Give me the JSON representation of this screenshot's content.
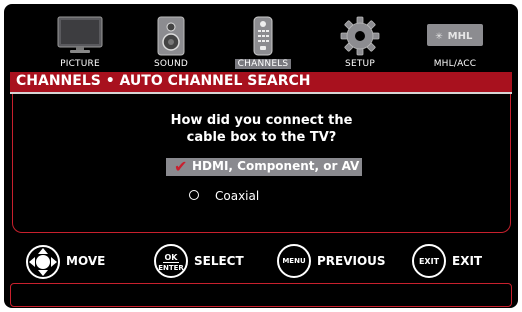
{
  "menu": {
    "tabs": [
      {
        "label": "PICTURE",
        "icon": "monitor-icon",
        "active": false
      },
      {
        "label": "SOUND",
        "icon": "speaker-icon",
        "active": false
      },
      {
        "label": "CHANNELS",
        "icon": "remote-icon",
        "active": true
      },
      {
        "label": "SETUP",
        "icon": "gear-icon",
        "active": false
      },
      {
        "label": "MHL/ACC",
        "icon": "mhl-logo",
        "active": false
      }
    ],
    "mhl_logo_text": "MHL"
  },
  "header": {
    "title": "CHANNELS • AUTO CHANNEL SEARCH"
  },
  "dialog": {
    "question_line1": "How did you connect the",
    "question_line2": "cable box to the TV?",
    "options": [
      {
        "label": "HDMI, Component, or AV",
        "selected": true
      },
      {
        "label": "Coaxial",
        "selected": false
      }
    ]
  },
  "footer": {
    "move": {
      "key": "",
      "label": "MOVE"
    },
    "select": {
      "key_line1": "OK",
      "key_line2": "ENTER",
      "label": "SELECT"
    },
    "previous": {
      "key": "MENU",
      "label": "PREVIOUS"
    },
    "exit": {
      "key": "EXIT",
      "label": "EXIT"
    }
  },
  "colors": {
    "accent_red": "#a8111e",
    "highlight_gray": "#8a8a8f",
    "background": "#000000"
  }
}
